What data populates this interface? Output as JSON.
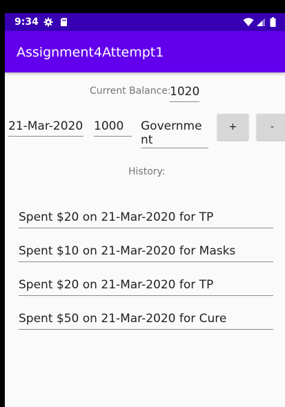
{
  "status_bar": {
    "time": "9:34",
    "icons": [
      "gear-icon",
      "sim-card-icon",
      "wifi-icon",
      "signal-icon",
      "battery-icon"
    ]
  },
  "app_bar": {
    "title": "Assignment4Attempt1",
    "color": "#6200ee"
  },
  "balance": {
    "label": "Current Balance:",
    "value": "1020"
  },
  "form": {
    "date": "21-Mar-2020",
    "amount": "1000",
    "reason": "Government",
    "add_label": "+",
    "subtract_label": "-"
  },
  "history": {
    "label": "History:",
    "items": [
      "Spent $20 on 21-Mar-2020 for TP",
      "Spent $10 on 21-Mar-2020 for Masks",
      "Spent $20 on 21-Mar-2020 for TP",
      "Spent $50 on 21-Mar-2020 for Cure"
    ]
  },
  "colors": {
    "status_bar": "#3700b3",
    "app_bar": "#6200ee",
    "background": "#fafafa"
  }
}
